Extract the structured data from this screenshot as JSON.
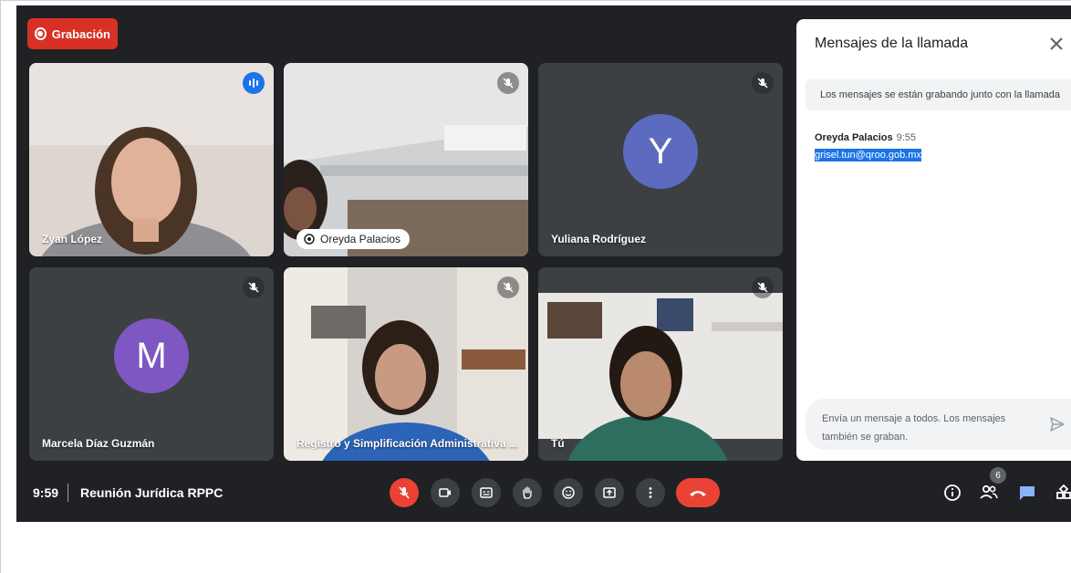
{
  "recording": {
    "label": "Grabación"
  },
  "participants": [
    {
      "name": "Zyan López",
      "mic": "speaking"
    },
    {
      "name": "Oreyda Palacios",
      "mic": "muted"
    },
    {
      "name": "Yuliana Rodríguez",
      "mic": "muted",
      "initial": "Y",
      "avatar_color": "#5c6bc0"
    },
    {
      "name": "Marcela Díaz Guzmán",
      "mic": "muted",
      "initial": "M",
      "avatar_color": "#7e57c2"
    },
    {
      "name": "Registro y Simplificación Administrativa ...",
      "mic": "muted"
    },
    {
      "name": "Tú",
      "mic": "muted"
    }
  ],
  "chat": {
    "title": "Mensajes de la llamada",
    "banner": "Los mensajes se están grabando junto con la llamada",
    "messages": [
      {
        "sender": "Oreyda Palacios",
        "time": "9:55",
        "text": "grisel.tun@qroo.gob.mx"
      }
    ],
    "input_placeholder": "Envía un mensaje a todos. Los mensajes también se graban."
  },
  "meeting": {
    "time": "9:59",
    "title": "Reunión Jurídica RPPC"
  },
  "people_count": "6",
  "colors": {
    "accent": "#1a73e8",
    "danger": "#ea4335",
    "background": "#202124",
    "tile": "#3c4043"
  }
}
